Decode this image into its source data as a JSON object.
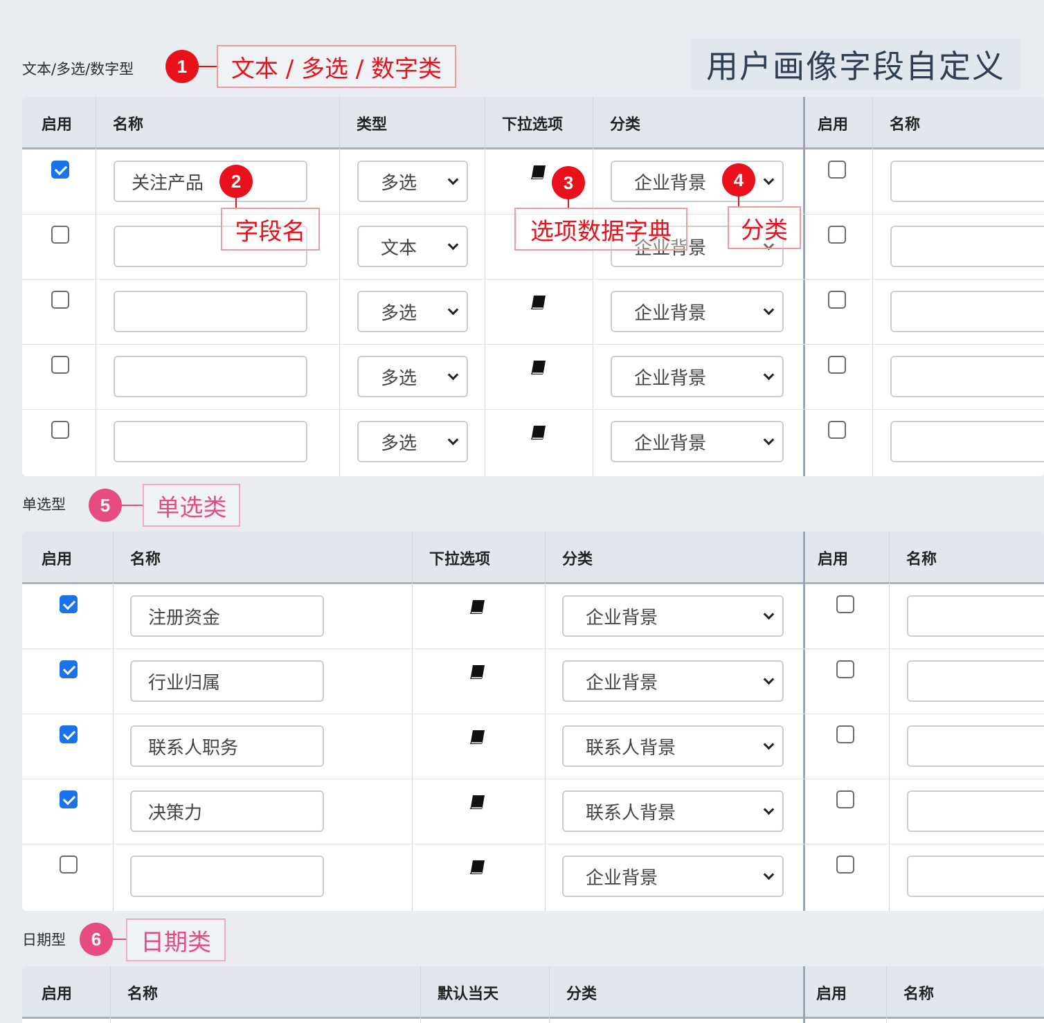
{
  "page_title": "用户画像字段自定义",
  "sections": {
    "text_multi_number": {
      "label": "文本/多选/数字型",
      "badge": "1",
      "callout": "文本 / 多选 / 数字类",
      "headers": [
        "启用",
        "名称",
        "类型",
        "下拉选项",
        "分类",
        "启用",
        "名称"
      ],
      "rows": [
        {
          "enabled": true,
          "name": "关注产品",
          "type": "多选",
          "has_options": true,
          "category": "企业背景"
        },
        {
          "enabled": false,
          "name": "",
          "type": "文本",
          "has_options": false,
          "category": "企业背景"
        },
        {
          "enabled": false,
          "name": "",
          "type": "多选",
          "has_options": true,
          "category": "企业背景"
        },
        {
          "enabled": false,
          "name": "",
          "type": "多选",
          "has_options": true,
          "category": "企业背景"
        },
        {
          "enabled": false,
          "name": "",
          "type": "多选",
          "has_options": true,
          "category": "企业背景"
        }
      ],
      "annotations": [
        {
          "badge": "2",
          "callout": "字段名"
        },
        {
          "badge": "3",
          "callout": "选项数据字典"
        },
        {
          "badge": "4",
          "callout": "分类"
        }
      ]
    },
    "single_select": {
      "label": "单选型",
      "badge": "5",
      "callout": "单选类",
      "headers": [
        "启用",
        "名称",
        "下拉选项",
        "分类",
        "启用",
        "名称"
      ],
      "rows": [
        {
          "enabled": true,
          "name": "注册资金",
          "has_options": true,
          "category": "企业背景"
        },
        {
          "enabled": true,
          "name": "行业归属",
          "has_options": true,
          "category": "企业背景"
        },
        {
          "enabled": true,
          "name": "联系人职务",
          "has_options": true,
          "category": "联系人背景"
        },
        {
          "enabled": true,
          "name": "决策力",
          "has_options": true,
          "category": "联系人背景"
        },
        {
          "enabled": false,
          "name": "",
          "has_options": true,
          "category": "企业背景"
        }
      ]
    },
    "date": {
      "label": "日期型",
      "badge": "6",
      "callout": "日期类",
      "headers": [
        "启用",
        "名称",
        "默认当天",
        "分类",
        "启用",
        "名称"
      ]
    }
  },
  "colors": {
    "badge_red": "#e8111c",
    "badge_pink": "#e64c7f",
    "checkbox_checked": "#1a73e8",
    "header_bg": "#e2e7ee",
    "page_bg": "#e9edf2"
  },
  "icons": {
    "options": "book-icon",
    "dropdown": "chevron-down-icon"
  }
}
